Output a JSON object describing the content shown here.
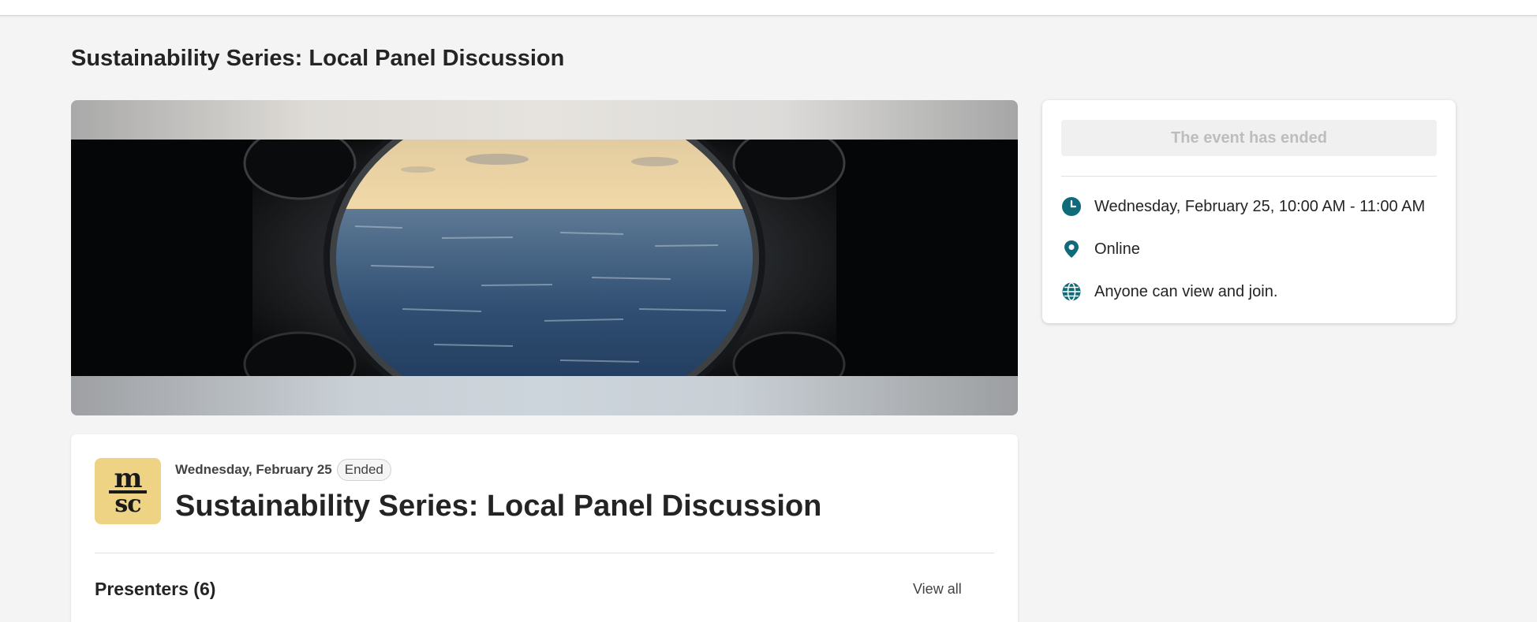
{
  "page": {
    "title": "Sustainability Series: Local Panel Discussion"
  },
  "banner": {
    "image_name": "porthole-ocean-view"
  },
  "info_card": {
    "status_button": "The event has ended",
    "rows": [
      {
        "icon": "clock-icon",
        "text": "Wednesday, February 25, 10:00 AM - 11:00 AM"
      },
      {
        "icon": "location-pin-icon",
        "text": "Online"
      },
      {
        "icon": "globe-icon",
        "text": "Anyone can view and join."
      }
    ]
  },
  "detail": {
    "logo_top": "m",
    "logo_bottom": "sc",
    "date": "Wednesday, February 25",
    "badge": "Ended",
    "title": "Sustainability Series: Local Panel Discussion",
    "presenters_label": "Presenters (6)",
    "view_all": "View all"
  },
  "colors": {
    "accent": "#0f6b7a",
    "logo_bg": "#efd385",
    "page_bg": "#f4f4f4"
  }
}
